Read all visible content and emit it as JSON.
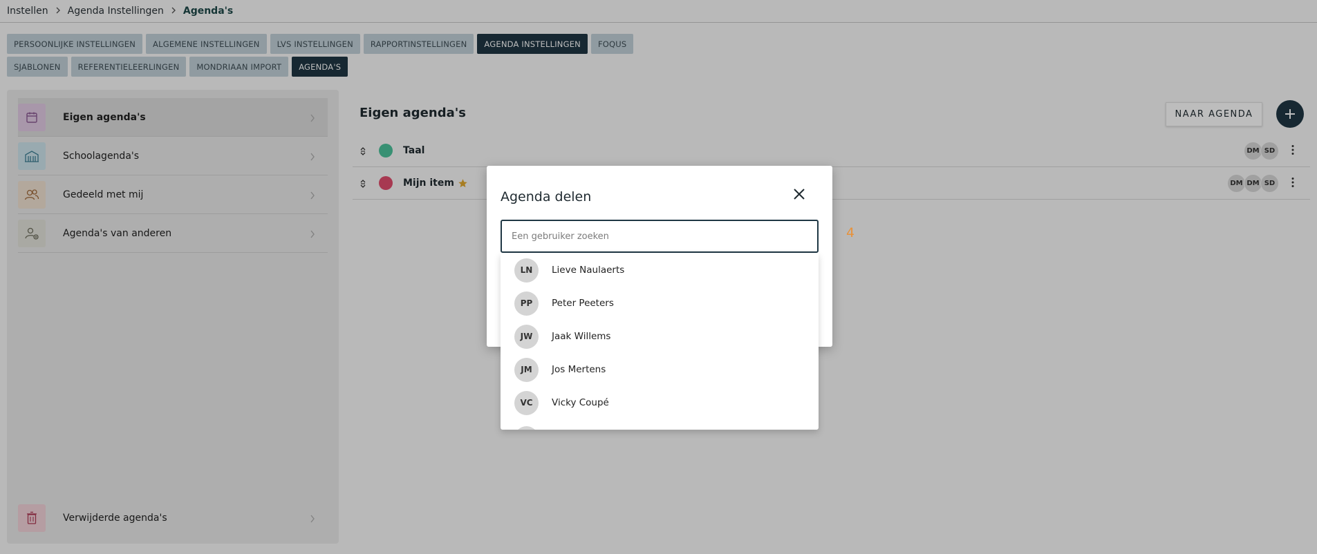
{
  "breadcrumb": [
    "Instellen",
    "Agenda Instellingen",
    "Agenda's"
  ],
  "tabs_row1": [
    {
      "label": "PERSOONLIJKE INSTELLINGEN",
      "active": false
    },
    {
      "label": "ALGEMENE INSTELLINGEN",
      "active": false
    },
    {
      "label": "LVS INSTELLINGEN",
      "active": false
    },
    {
      "label": "RAPPORTINSTELLINGEN",
      "active": false
    },
    {
      "label": "AGENDA INSTELLINGEN",
      "active": true
    },
    {
      "label": "FOQUS",
      "active": false
    }
  ],
  "tabs_row2": [
    {
      "label": "SJABLONEN",
      "active": false
    },
    {
      "label": "REFERENTIELEERLINGEN",
      "active": false
    },
    {
      "label": "MONDRIAAN IMPORT",
      "active": false
    },
    {
      "label": "AGENDA'S",
      "active": true
    }
  ],
  "sidebar": {
    "items": [
      {
        "label": "Eigen agenda's",
        "icon": "calendar-icon",
        "color": "#e3cce6",
        "stroke": "#8c5a93",
        "active": true
      },
      {
        "label": "Schoolagenda's",
        "icon": "school-icon",
        "color": "#cfe6ee",
        "stroke": "#3d7f95",
        "active": false
      },
      {
        "label": "Gedeeld met mij",
        "icon": "users-icon",
        "color": "#f2e3d3",
        "stroke": "#a36b3c",
        "active": false
      },
      {
        "label": "Agenda's van anderen",
        "icon": "user-share-icon",
        "color": "#e4e4dc",
        "stroke": "#6e6e5e",
        "active": false
      }
    ],
    "deleted": {
      "label": "Verwijderde agenda's",
      "icon": "trash-icon",
      "color": "#f4d4db",
      "stroke": "#b03a56"
    }
  },
  "content": {
    "title": "Eigen agenda's",
    "naar_agenda_label": "NAAR AGENDA",
    "agendas": [
      {
        "name": "Taal",
        "color": "#4cc39b",
        "star": false,
        "avatars": [
          "DM",
          "SD"
        ]
      },
      {
        "name": "Mijn item",
        "color": "#e24d6e",
        "star": true,
        "avatars": [
          "DM",
          "DM",
          "SD"
        ]
      }
    ]
  },
  "modal": {
    "title": "Agenda delen",
    "search_placeholder": "Een gebruiker zoeken",
    "counter": "4",
    "users": [
      {
        "initials": "LN",
        "name": "Lieve Naulaerts"
      },
      {
        "initials": "PP",
        "name": "Peter Peeters"
      },
      {
        "initials": "JW",
        "name": "Jaak Willems"
      },
      {
        "initials": "JM",
        "name": "Jos Mertens"
      },
      {
        "initials": "VC",
        "name": "Vicky Coupé"
      }
    ]
  },
  "colors": {
    "accent": "#1f3744",
    "star": "#e2a92f",
    "counter": "#e8923a"
  }
}
